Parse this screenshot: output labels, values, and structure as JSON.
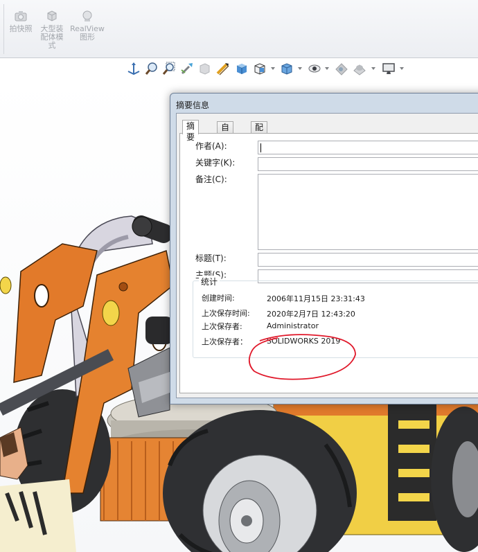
{
  "ribbon": {
    "buttons": [
      {
        "label_line1": "拍快照",
        "label_line2": "",
        "label_line3": "",
        "icon": "camera-icon"
      },
      {
        "label_line1": "大型装",
        "label_line2": "配体模",
        "label_line3": "式",
        "icon": "large-assembly-icon"
      },
      {
        "label_line1": "RealView",
        "label_line2": "图形",
        "label_line3": "",
        "icon": "realview-icon"
      }
    ]
  },
  "view_toolbar": {
    "icons": [
      "view-orientation-icon",
      "zoom-to-fit-icon",
      "zoom-area-icon",
      "previous-view-icon",
      "section-view-icon",
      "dynamic-annotation-icon",
      "view-orientation-cube-icon",
      "display-style-icon",
      "hide-show-items-icon",
      "edit-appearance-icon",
      "apply-scene-icon",
      "view-settings-icon",
      "display-monitor-icon"
    ]
  },
  "dialog": {
    "title": "摘要信息",
    "tabs": [
      "摘要",
      "自定义",
      "配置特定"
    ],
    "active_tab": "摘要",
    "fields": {
      "author_label": "作者(A):",
      "author_value": "",
      "keywords_label": "关键字(K):",
      "keywords_value": "",
      "comments_label": "备注(C):",
      "comments_value": "",
      "title_label": "标题(T):",
      "title_value": "",
      "subject_label": "主题(S):",
      "subject_value": ""
    },
    "statistics": {
      "legend": "统计",
      "created_label": "创建时间:",
      "created_value": "2006年11月15日 23:31:43",
      "last_saved_label": "上次保存时间:",
      "last_saved_value": "2020年2月7日 12:43:20",
      "last_saved_by_label": "上次保存者:",
      "last_saved_by_value": "Administrator",
      "last_saved_with_label": "上次保存者：",
      "last_saved_with_value": "SOLIDWORKS 2019"
    }
  },
  "colors": {
    "model_orange": "#e07a2c",
    "model_yellow": "#f3d54a",
    "annotation_red": "#e0182a",
    "dialog_frame": "#cfdbe8"
  }
}
